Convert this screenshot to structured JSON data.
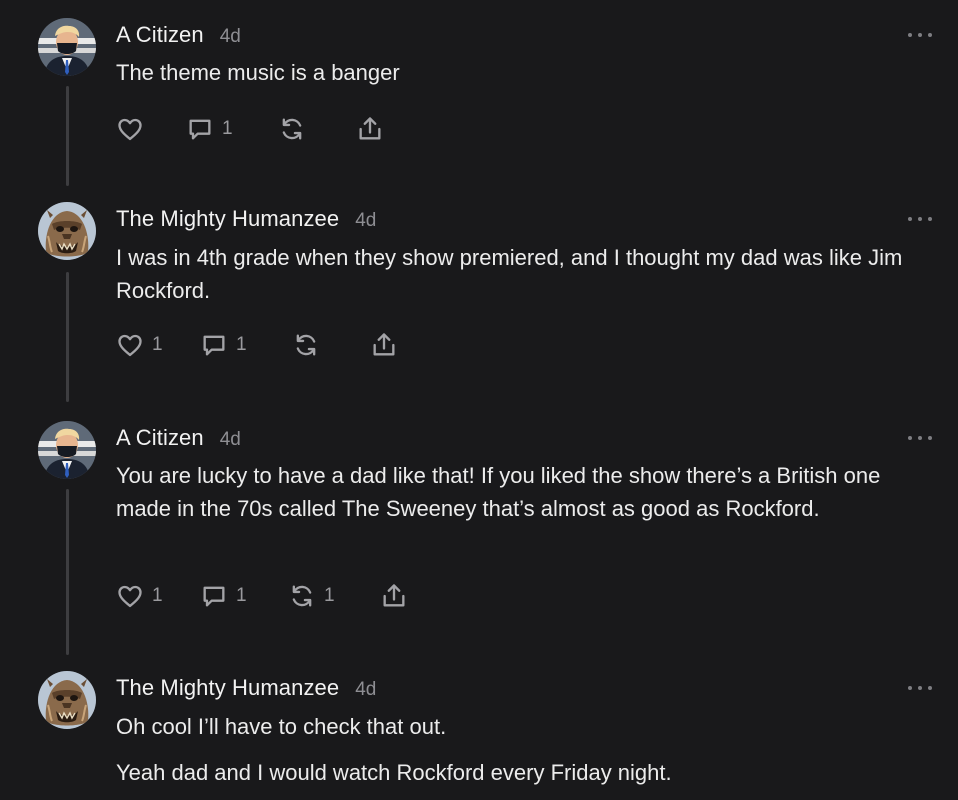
{
  "comments": [
    {
      "author": "A Citizen",
      "time": "4d",
      "avatar_icon": "person-masked-avatar",
      "paragraphs": [
        "The theme music is a banger"
      ],
      "likes": "",
      "replies": "1",
      "restacks": "",
      "share": ""
    },
    {
      "author": "The Mighty Humanzee",
      "time": "4d",
      "avatar_icon": "gorilla-mask-avatar",
      "paragraphs": [
        "I was in 4th grade when they show premiered, and I thought my dad was like Jim Rockford."
      ],
      "likes": "1",
      "replies": "1",
      "restacks": "",
      "share": ""
    },
    {
      "author": "A Citizen",
      "time": "4d",
      "avatar_icon": "person-masked-avatar",
      "paragraphs": [
        "You are lucky to have a dad like that! If you liked the show there’s a British one made in the 70s called The Sweeney that’s almost as good as Rockford."
      ],
      "likes": "1",
      "replies": "1",
      "restacks": "1",
      "share": ""
    },
    {
      "author": "The Mighty Humanzee",
      "time": "4d",
      "avatar_icon": "gorilla-mask-avatar",
      "paragraphs": [
        "Oh cool I’ll have to check that out.",
        "Yeah dad and I would watch Rockford every Friday night."
      ]
    }
  ],
  "colors": {
    "background": "#19191b",
    "text": "#ececec",
    "muted": "#8e8e93",
    "thread_line": "#3d3d40"
  }
}
